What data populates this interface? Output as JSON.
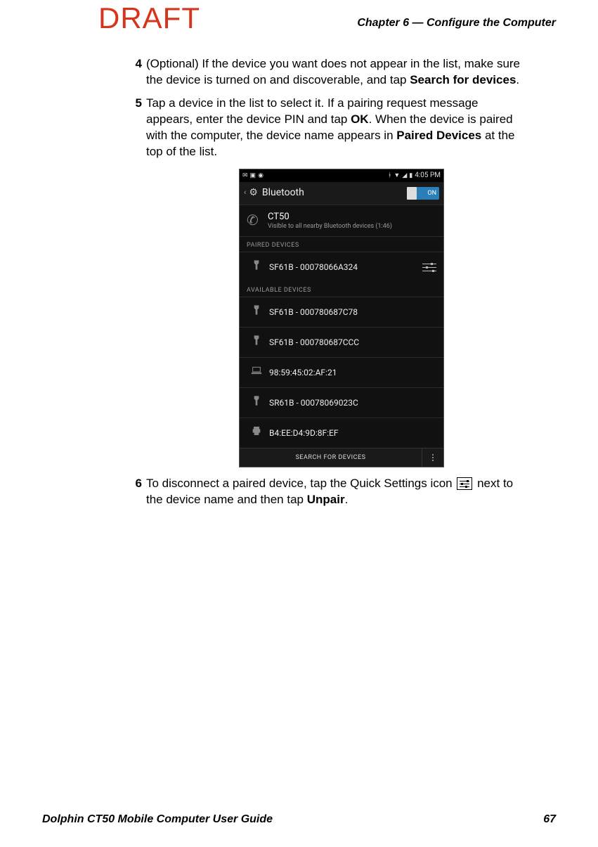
{
  "watermark": "DRAFT",
  "header": {
    "chapter": "Chapter 6 — Configure the Computer"
  },
  "steps": {
    "s4": {
      "num": "4",
      "prefix": "(Optional) If the device you want does not appear in the list, make sure the device is turned on and discoverable, and tap ",
      "bold1": "Search for devices",
      "suffix": "."
    },
    "s5": {
      "num": "5",
      "t1": "Tap a device in the list to select it. If a pairing request message appears, enter the device PIN and tap ",
      "bold1": "OK",
      "t2": ". When the device is paired with the computer, the device name appears in ",
      "bold2": "Paired Devices",
      "t3": " at the top of the list."
    },
    "s6": {
      "num": "6",
      "t1": "To disconnect a paired device, tap the Quick Settings icon ",
      "t2": " next to the device name and then tap ",
      "bold1": "Unpair",
      "t3": "."
    }
  },
  "screenshot": {
    "statusbar": {
      "time": "4:05 PM"
    },
    "titlebar": {
      "title": "Bluetooth",
      "toggle": "ON"
    },
    "self": {
      "name": "CT50",
      "sub": "Visible to all nearby Bluetooth devices (1:46)"
    },
    "paired_label": "PAIRED DEVICES",
    "paired": [
      {
        "name": "SF61B - 00078066A324"
      }
    ],
    "avail_label": "AVAILABLE DEVICES",
    "available": [
      {
        "name": "SF61B - 000780687C78",
        "icon": "scanner"
      },
      {
        "name": "SF61B - 000780687CCC",
        "icon": "scanner"
      },
      {
        "name": "98:59:45:02:AF:21",
        "icon": "laptop"
      },
      {
        "name": "SR61B - 00078069023C",
        "icon": "scanner"
      },
      {
        "name": "B4:EE:D4:9D:8F:EF",
        "icon": "printer"
      }
    ],
    "bottom": {
      "search": "SEARCH FOR DEVICES"
    }
  },
  "footer": {
    "title": "Dolphin CT50 Mobile Computer User Guide",
    "page": "67"
  }
}
